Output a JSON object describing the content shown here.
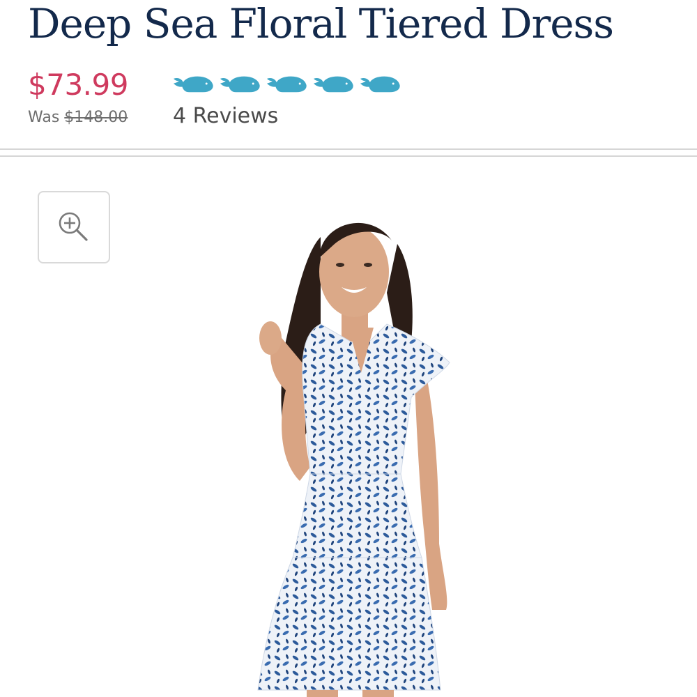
{
  "product": {
    "title": "Deep Sea Floral Tiered Dress",
    "sale_price": "$73.99",
    "was_label": "Was",
    "was_price": "$148.00",
    "rating": {
      "value": 5,
      "max": 5,
      "icon": "whale-icon",
      "reviews_label": "4 Reviews"
    }
  },
  "gallery": {
    "zoom_icon": "zoom-in-icon",
    "image_alt": "Model wearing the Deep Sea Floral Tiered Dress"
  },
  "colors": {
    "title": "#13294b",
    "sale_price": "#cf3a5e",
    "whale": "#3fa7c7",
    "dress_blue": "#2c5a9a",
    "divider": "#d6d6d6"
  }
}
